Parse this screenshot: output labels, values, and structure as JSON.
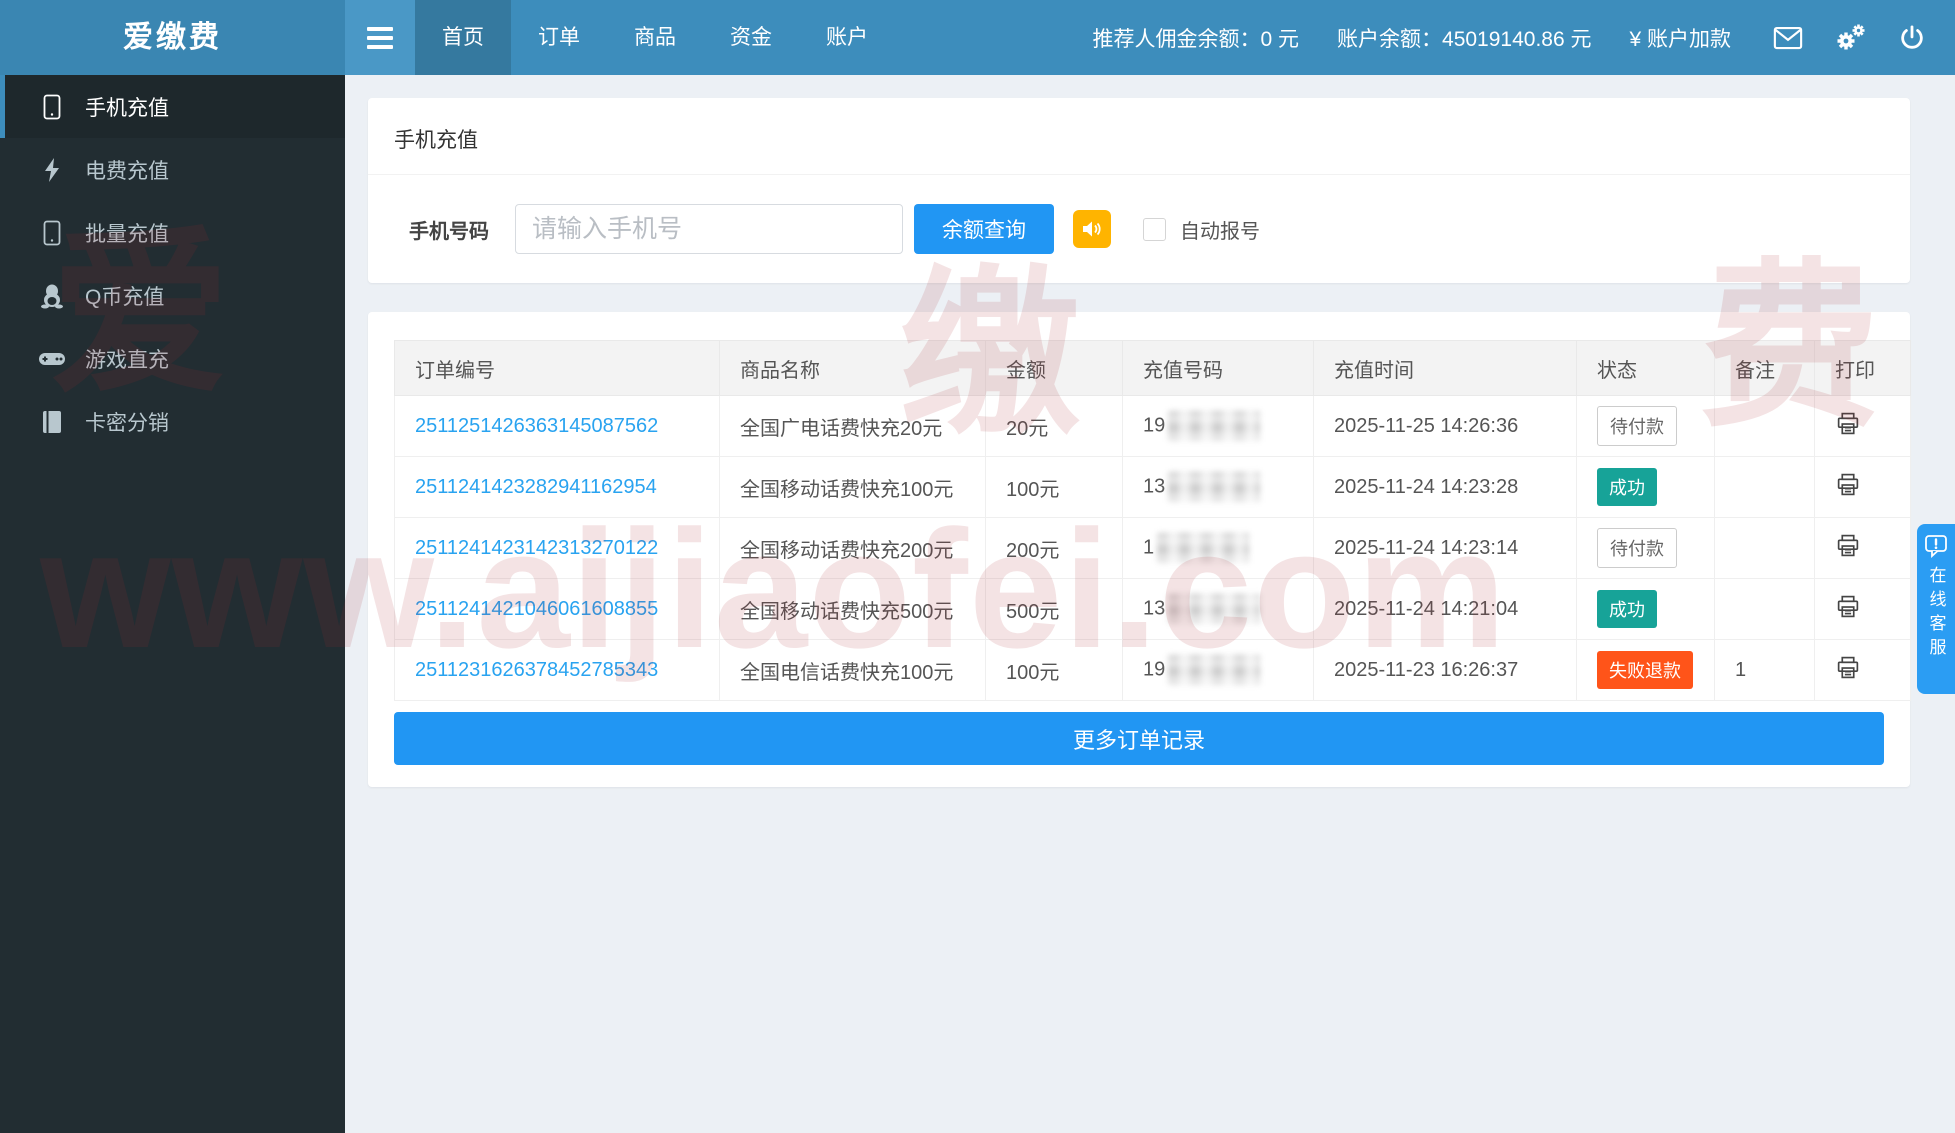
{
  "navbar": {
    "brand": "爱缴费",
    "items": [
      "首页",
      "订单",
      "商品",
      "资金",
      "账户"
    ],
    "commission_label": "推荐人佣金余额：",
    "commission_value": "0 元",
    "balance_label": "账户余额：",
    "balance_value": "45019140.86 元",
    "add_funds": "¥ 账户加款"
  },
  "sidebar": {
    "items": [
      {
        "label": "手机充值",
        "icon": "phone-icon",
        "active": true
      },
      {
        "label": "电费充值",
        "icon": "bolt-icon",
        "active": false
      },
      {
        "label": "批量充值",
        "icon": "phone-icon",
        "active": false
      },
      {
        "label": "Q币充值",
        "icon": "qq-penguin-icon",
        "active": false
      },
      {
        "label": "游戏直充",
        "icon": "gamepad-icon",
        "active": false
      },
      {
        "label": "卡密分销",
        "icon": "book-icon",
        "active": false
      }
    ]
  },
  "panel": {
    "title": "手机充值",
    "phone_label": "手机号码",
    "phone_placeholder": "请输入手机号",
    "query_button": "余额查询",
    "auto_report_label": "自动报号"
  },
  "orders": {
    "headers": [
      "订单编号",
      "商品名称",
      "金额",
      "充值号码",
      "充值时间",
      "状态",
      "备注",
      "打印"
    ],
    "rows": [
      {
        "order_no": "2511251426363145087562",
        "product": "全国广电话费快充20元",
        "amount": "20元",
        "phone_prefix": "19",
        "time": "2025-11-25 14:26:36",
        "status": "待付款",
        "status_type": "pending",
        "remark": ""
      },
      {
        "order_no": "2511241423282941162954",
        "product": "全国移动话费快充100元",
        "amount": "100元",
        "phone_prefix": "13",
        "time": "2025-11-24 14:23:28",
        "status": "成功",
        "status_type": "success",
        "remark": ""
      },
      {
        "order_no": "2511241423142313270122",
        "product": "全国移动话费快充200元",
        "amount": "200元",
        "phone_prefix": "1",
        "time": "2025-11-24 14:23:14",
        "status": "待付款",
        "status_type": "pending",
        "remark": ""
      },
      {
        "order_no": "2511241421046061608855",
        "product": "全国移动话费快充500元",
        "amount": "500元",
        "phone_prefix": "13",
        "time": "2025-11-24 14:21:04",
        "status": "成功",
        "status_type": "success",
        "remark": ""
      },
      {
        "order_no": "2511231626378452785343",
        "product": "全国电信话费快充100元",
        "amount": "100元",
        "phone_prefix": "19",
        "time": "2025-11-23 16:26:37",
        "status": "失败退款",
        "status_type": "failed",
        "remark": "1"
      }
    ],
    "more_button": "更多订单记录"
  },
  "service_tab": {
    "label": "在线客服"
  },
  "watermark": {
    "url": "www.aijiaofei.com",
    "chars": [
      "爱",
      "缴",
      "费"
    ]
  },
  "colors": {
    "navbar": "#3d8dbc",
    "sidebar": "#222d32",
    "primary": "#2196f3",
    "success": "#17a398",
    "danger": "#ff5419",
    "warning": "#ffb400",
    "link": "#29a3f0",
    "content_bg": "#ecf0f5"
  }
}
